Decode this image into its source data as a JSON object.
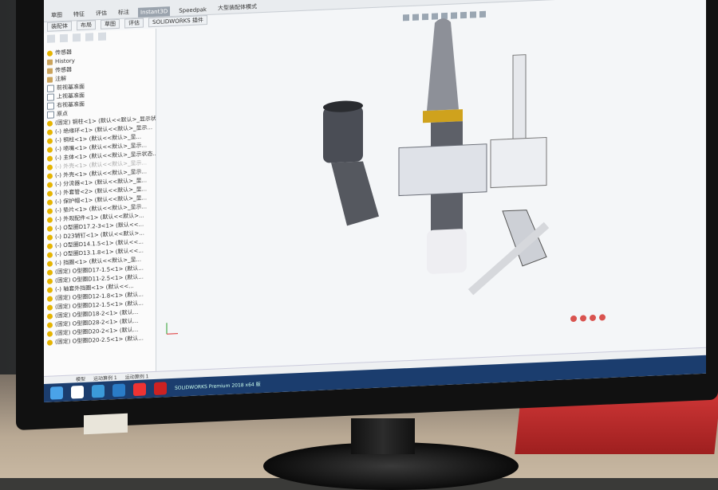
{
  "ribbon": {
    "buttons": [
      "草图",
      "特征",
      "评估",
      "标注",
      "Instant3D",
      "Speedpak",
      "大型装配体模式"
    ],
    "active_index": 4
  },
  "tabs": [
    "装配体",
    "布局",
    "草图",
    "评估",
    "SOLIDWORKS 插件"
  ],
  "tree": {
    "root": "传感器",
    "items": [
      {
        "label": "History",
        "kind": "folder"
      },
      {
        "label": "传感器",
        "kind": "folder"
      },
      {
        "label": "注解",
        "kind": "folder"
      },
      {
        "label": "前视基准面",
        "kind": "plane"
      },
      {
        "label": "上视基准面",
        "kind": "plane"
      },
      {
        "label": "右视基准面",
        "kind": "plane"
      },
      {
        "label": "原点",
        "kind": "plane"
      },
      {
        "label": "(固定) 铜柱<1> (默认<<默认>_显示状态 1>)",
        "kind": "part"
      },
      {
        "label": "(-) 绝缘环<1> (默认<<默认>_显示...",
        "kind": "part"
      },
      {
        "label": "(-) 铜柱<1> (默认<<默认>_显...",
        "kind": "part"
      },
      {
        "label": "(-) 喷嘴<1> (默认<<默认>_显示...",
        "kind": "part"
      },
      {
        "label": "(-) 主体<1> (默认<<默认>_显示状态...",
        "kind": "part"
      },
      {
        "label": "(-) 外壳<1> (默认<<默认>_显示...",
        "kind": "dim"
      },
      {
        "label": "(-) 外壳<1> (默认<<默认>_显示...",
        "kind": "part"
      },
      {
        "label": "(-) 分流器<1> (默认<<默认>_显...",
        "kind": "part"
      },
      {
        "label": "(-) 外套管<2> (默认<<默认>_显...",
        "kind": "part"
      },
      {
        "label": "(-) 保护帽<1> (默认<<默认>_显...",
        "kind": "part"
      },
      {
        "label": "(-) 垫片<1> (默认<<默认>_显示...",
        "kind": "part"
      },
      {
        "label": "(-) 外观配件<1> (默认<<默认>...",
        "kind": "part"
      },
      {
        "label": "(-) O型圈D17.2-3<1> (默认<<...",
        "kind": "part"
      },
      {
        "label": "(-) D23销钉<1> (默认<<默认>...",
        "kind": "part"
      },
      {
        "label": "(-) O型圈D14.1.5<1> (默认<<...",
        "kind": "part"
      },
      {
        "label": "(-) O型圈D13.1.8<1> (默认<<...",
        "kind": "part"
      },
      {
        "label": "(-) 挡圈<1> (默认<<默认>_显...",
        "kind": "part"
      },
      {
        "label": "(固定) O型圈D17-1.5<1> (默认...",
        "kind": "part"
      },
      {
        "label": "(固定) O型圈D11-2.5<1> (默认...",
        "kind": "part"
      },
      {
        "label": "(-) 轴套外挡圈<1> (默认<<...",
        "kind": "part"
      },
      {
        "label": "(固定) O型圈D12-1.8<1> (默认...",
        "kind": "part"
      },
      {
        "label": "(固定) O型圈D12-1.5<1> (默认...",
        "kind": "part"
      },
      {
        "label": "(固定) O型圈D18-2<1> (默认...",
        "kind": "part"
      },
      {
        "label": "(固定) O型圈D28-2<1> (默认...",
        "kind": "part"
      },
      {
        "label": "(固定) O型圈D20-2<1> (默认...",
        "kind": "part"
      },
      {
        "label": "(固定) O型圈D20-2.5<1> (默认...",
        "kind": "part"
      }
    ]
  },
  "status_tabs": [
    "模型",
    "运动算例 1",
    "运动算例 1"
  ],
  "taskbar_caption": "SOLIDWORKS Premium 2018 x64 版",
  "colors": {
    "taskbar": "#1b3d6e",
    "accent": "#e5b400"
  },
  "icons": [
    "windows-start-icon",
    "chrome-icon",
    "browser-icon",
    "app-icon",
    "wps-icon",
    "solidworks-icon"
  ]
}
